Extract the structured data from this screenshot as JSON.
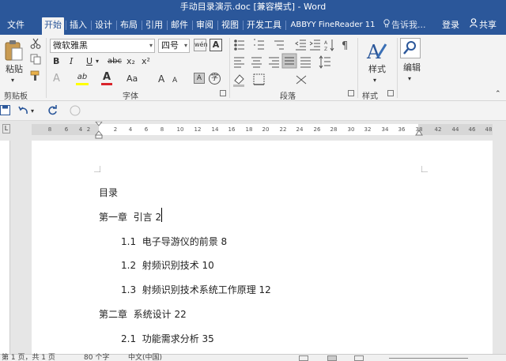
{
  "window": {
    "title": "手动目录演示.doc [兼容模式] - Word"
  },
  "tabs": [
    {
      "label": "文件"
    },
    {
      "label": "开始"
    },
    {
      "label": "插入"
    },
    {
      "label": "设计"
    },
    {
      "label": "布局"
    },
    {
      "label": "引用"
    },
    {
      "label": "邮件"
    },
    {
      "label": "审阅"
    },
    {
      "label": "视图"
    },
    {
      "label": "开发工具"
    },
    {
      "label": "ABBYY FineReader 11"
    }
  ],
  "active_tab": "开始",
  "tell_me": "告诉我...",
  "login": "登录",
  "share": "共享",
  "ribbon": {
    "clipboard": {
      "paste_label": "粘贴",
      "group_label": "剪贴板"
    },
    "font": {
      "font_name": "微软雅黑",
      "font_size": "四号",
      "group_label": "字体",
      "bold": "B",
      "italic": "I",
      "underline": "U",
      "strike": "abc",
      "sub": "x₂",
      "sup": "x²",
      "effects": "A",
      "highlight": "ab",
      "font_color": "A",
      "case": "Aa",
      "grow": "A",
      "shrink": "A",
      "clear": "A",
      "phonetic": "wén",
      "char_border": "A",
      "enclose": "字"
    },
    "paragraph": {
      "group_label": "段落"
    },
    "styles": {
      "label": "样式",
      "group_label": "样式"
    },
    "editing": {
      "label": "编辑"
    },
    "accent": "#2b579a",
    "font_color_bar": "#d9242b",
    "highlight_bar": "#ffff00"
  },
  "ruler_ticks": [
    "8",
    "6",
    "4",
    "2",
    "2",
    "4",
    "6",
    "8",
    "10",
    "12",
    "14",
    "16",
    "18",
    "20",
    "22",
    "24",
    "26",
    "28",
    "30",
    "32",
    "34",
    "36",
    "38",
    "42",
    "44",
    "46",
    "48"
  ],
  "document": {
    "lines": [
      {
        "text": "目录",
        "level": 0
      },
      {
        "text": "第一章  引言 2",
        "level": 0
      },
      {
        "text": "1.1  电子导游仪的前景 8",
        "level": 1
      },
      {
        "text": "1.2  射频识别技术 10",
        "level": 1
      },
      {
        "text": "1.3  射频识别技术系统工作原理 12",
        "level": 1
      },
      {
        "text": "第二章  系统设计 22",
        "level": 0
      },
      {
        "text": "2.1  功能需求分析 35",
        "level": 1
      }
    ]
  },
  "status": {
    "page": "第 1 页，共 1 页",
    "words": "80 个字",
    "language": "中文(中国)"
  }
}
